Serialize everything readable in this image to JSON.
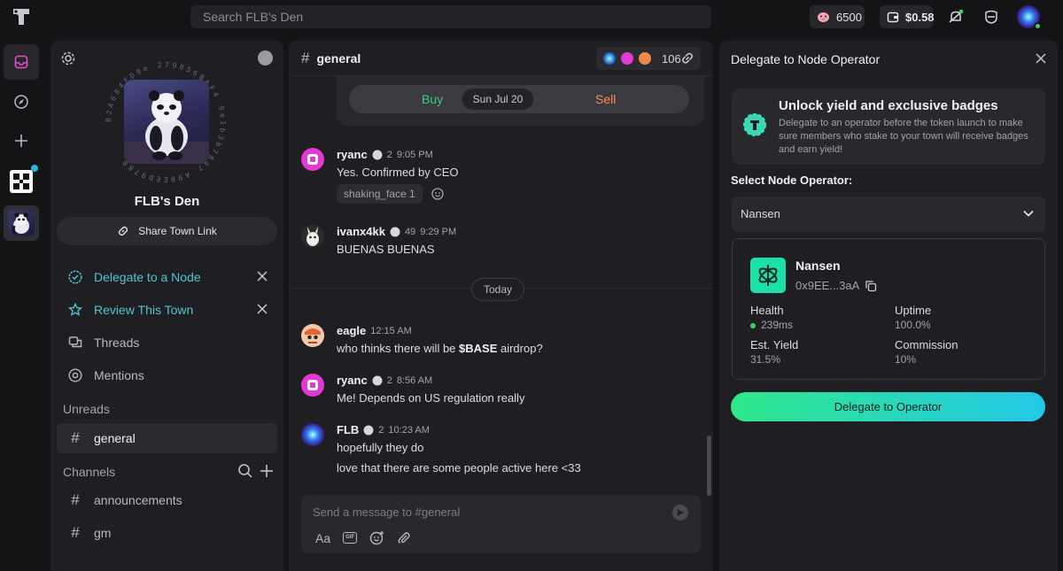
{
  "topbar": {
    "search_placeholder": "Search FLB's Den",
    "points": "6500",
    "balance": "$0.58"
  },
  "town": {
    "name": "FLB's Den",
    "ring_text_top": "82A684FD9e",
    "ring_text_bottom": "9b7e89...",
    "share_label": "Share Town Link",
    "nav": {
      "delegate": "Delegate to a Node",
      "review": "Review This Town",
      "threads": "Threads",
      "mentions": "Mentions"
    },
    "unreads_label": "Unreads",
    "unread_channel": "general",
    "channels_label": "Channels",
    "channels": [
      "announcements",
      "gm"
    ]
  },
  "chat": {
    "channel": "general",
    "member_count": "106",
    "poll": {
      "buy": "Buy",
      "sell": "Sell",
      "date": "Sun Jul 20"
    },
    "messages": [
      {
        "user": "ryanc",
        "level": "2",
        "time": "9:05 PM",
        "text": "Yes. Confirmed by CEO",
        "reaction": "shaking_face 1"
      },
      {
        "user": "ivanx4kk",
        "level": "49",
        "time": "9:29 PM",
        "text": "BUENAS BUENAS"
      },
      {
        "user": "eagle",
        "time": "12:15 AM",
        "text_pre": "who thinks there will be ",
        "text_bold": "$BASE",
        "text_post": " airdrop?"
      },
      {
        "user": "ryanc",
        "level": "2",
        "time": "8:56 AM",
        "text": "Me! Depends on US regulation really"
      },
      {
        "user": "FLB",
        "level": "2",
        "time": "10:23 AM",
        "text": "hopefully they do",
        "text2": "love that there are some people active here <33"
      }
    ],
    "today_label": "Today",
    "composer_placeholder": "Send a message to #general",
    "format_label": "Aa",
    "gif_label": "GIF"
  },
  "panel": {
    "title": "Delegate to Node Operator",
    "unlock_title": "Unlock yield and exclusive badges",
    "unlock_desc": "Delegate to an operator before the token launch to make sure members who stake to your town will receive badges and earn yield!",
    "select_label": "Select Node Operator:",
    "selected": "Nansen",
    "operator": {
      "name": "Nansen",
      "address": "0x9EE...3aA",
      "health_label": "Health",
      "health_value": "239ms",
      "uptime_label": "Uptime",
      "uptime_value": "100.0%",
      "yield_label": "Est. Yield",
      "yield_value": "31.5%",
      "commission_label": "Commission",
      "commission_value": "10%"
    },
    "cta": "Delegate to Operator"
  },
  "colors": {
    "accent_teal": "#4fc6cc",
    "buy_green": "#3ad07a",
    "sell_orange": "#ff8a5b",
    "cta_start": "#2ee88a",
    "cta_end": "#22c8e8"
  }
}
